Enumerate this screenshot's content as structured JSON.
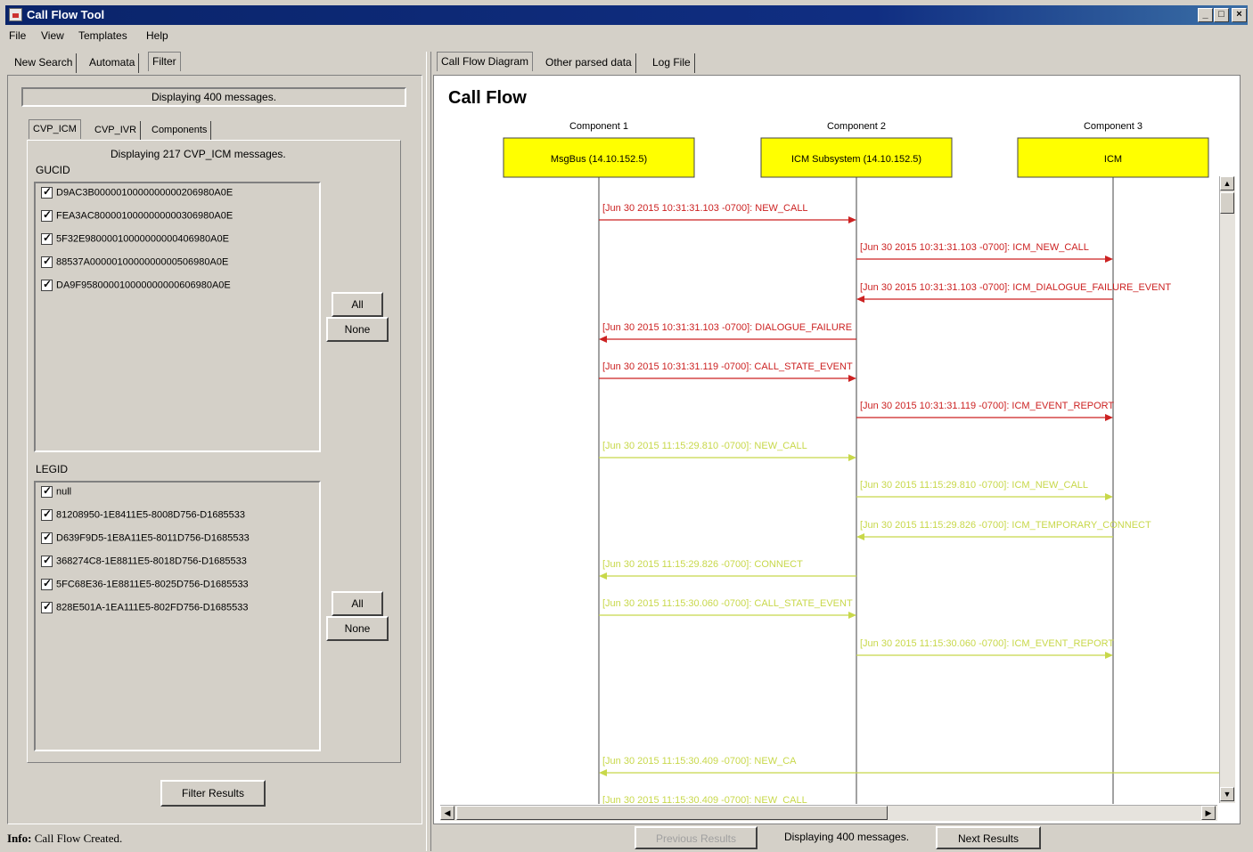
{
  "window": {
    "title": "Call Flow Tool"
  },
  "menu": [
    "File",
    "View",
    "Templates",
    "Help"
  ],
  "left_tabs": [
    "New Search",
    "Automata",
    "Filter"
  ],
  "left_active_tab": "Filter",
  "filter": {
    "banner": "Displaying 400 messages.",
    "sub_tabs": [
      "CVP_ICM",
      "CVP_IVR",
      "Components"
    ],
    "sub_active_tab": "CVP_ICM",
    "sub_message": "Displaying 217 CVP_ICM messages.",
    "gucid_label": "GUCID",
    "gucid_items": [
      "D9AC3B0000010000000000206980A0E",
      "FEA3AC8000010000000000306980A0E",
      "5F32E98000010000000000406980A0E",
      "88537A0000010000000000506980A0E",
      "DA9F958000010000000000606980A0E"
    ],
    "legid_label": "LEGID",
    "legid_items": [
      "null",
      "81208950-1E8411E5-8008D756-D1685533",
      "D639F9D5-1E8A11E5-8011D756-D1685533",
      "368274C8-1E8811E5-8018D756-D1685533",
      "5FC68E36-1E8811E5-8025D756-D1685533",
      "828E501A-1EA111E5-802FD756-D1685533"
    ],
    "all_label": "All",
    "none_label": "None",
    "filter_results_label": "Filter Results"
  },
  "right_tabs": [
    "Call Flow Diagram",
    "Other parsed data",
    "Log File"
  ],
  "right_active_tab": "Call Flow Diagram",
  "diagram": {
    "title": "Call Flow",
    "components": [
      {
        "header": "Component 1",
        "name": "MsgBus (14.10.152.5)"
      },
      {
        "header": "Component 2",
        "name": "ICM Subsystem (14.10.152.5)"
      },
      {
        "header": "Component 3",
        "name": "ICM"
      }
    ],
    "messages": [
      {
        "from": 0,
        "to": 1,
        "label": "[Jun 30 2015 10:31:31.103 -0700]: NEW_CALL",
        "color": "#cc2222"
      },
      {
        "from": 1,
        "to": 2,
        "label": "[Jun 30 2015 10:31:31.103 -0700]: ICM_NEW_CALL",
        "color": "#cc2222"
      },
      {
        "from": 2,
        "to": 1,
        "label": "[Jun 30 2015 10:31:31.103 -0700]: ICM_DIALOGUE_FAILURE_EVENT",
        "color": "#cc2222"
      },
      {
        "from": 1,
        "to": 0,
        "label": "[Jun 30 2015 10:31:31.103 -0700]: DIALOGUE_FAILURE",
        "color": "#cc2222"
      },
      {
        "from": 0,
        "to": 1,
        "label": "[Jun 30 2015 10:31:31.119 -0700]: CALL_STATE_EVENT",
        "color": "#cc2222"
      },
      {
        "from": 1,
        "to": 2,
        "label": "[Jun 30 2015 10:31:31.119 -0700]: ICM_EVENT_REPORT",
        "color": "#cc2222"
      },
      {
        "from": 0,
        "to": 1,
        "label": "[Jun 30 2015 11:15:29.810 -0700]: NEW_CALL",
        "color": "#c8d84a"
      },
      {
        "from": 1,
        "to": 2,
        "label": "[Jun 30 2015 11:15:29.810 -0700]: ICM_NEW_CALL",
        "color": "#c8d84a"
      },
      {
        "from": 2,
        "to": 1,
        "label": "[Jun 30 2015 11:15:29.826 -0700]: ICM_TEMPORARY_CONNECT",
        "color": "#c8d84a"
      },
      {
        "from": 1,
        "to": 0,
        "label": "[Jun 30 2015 11:15:29.826 -0700]: CONNECT",
        "color": "#c8d84a"
      },
      {
        "from": 0,
        "to": 1,
        "label": "[Jun 30 2015 11:15:30.060 -0700]: CALL_STATE_EVENT",
        "color": "#c8d84a"
      },
      {
        "from": 1,
        "to": 2,
        "label": "[Jun 30 2015 11:15:30.060 -0700]: ICM_EVENT_REPORT",
        "color": "#c8d84a"
      },
      {
        "from": 3,
        "to": 0,
        "label": "[Jun 30 2015 11:15:30.409 -0700]: NEW_CA",
        "color": "#c8d84a"
      },
      {
        "from": 0,
        "to": 1,
        "label": "[Jun 30 2015 11:15:30.409 -0700]: NEW_CALL",
        "color": "#c8d84a"
      }
    ]
  },
  "bottom": {
    "previous_label": "Previous Results",
    "status_label": "Displaying 400 messages.",
    "next_label": "Next Results"
  },
  "status": {
    "prefix": "Info:",
    "text": "Call Flow Created."
  }
}
